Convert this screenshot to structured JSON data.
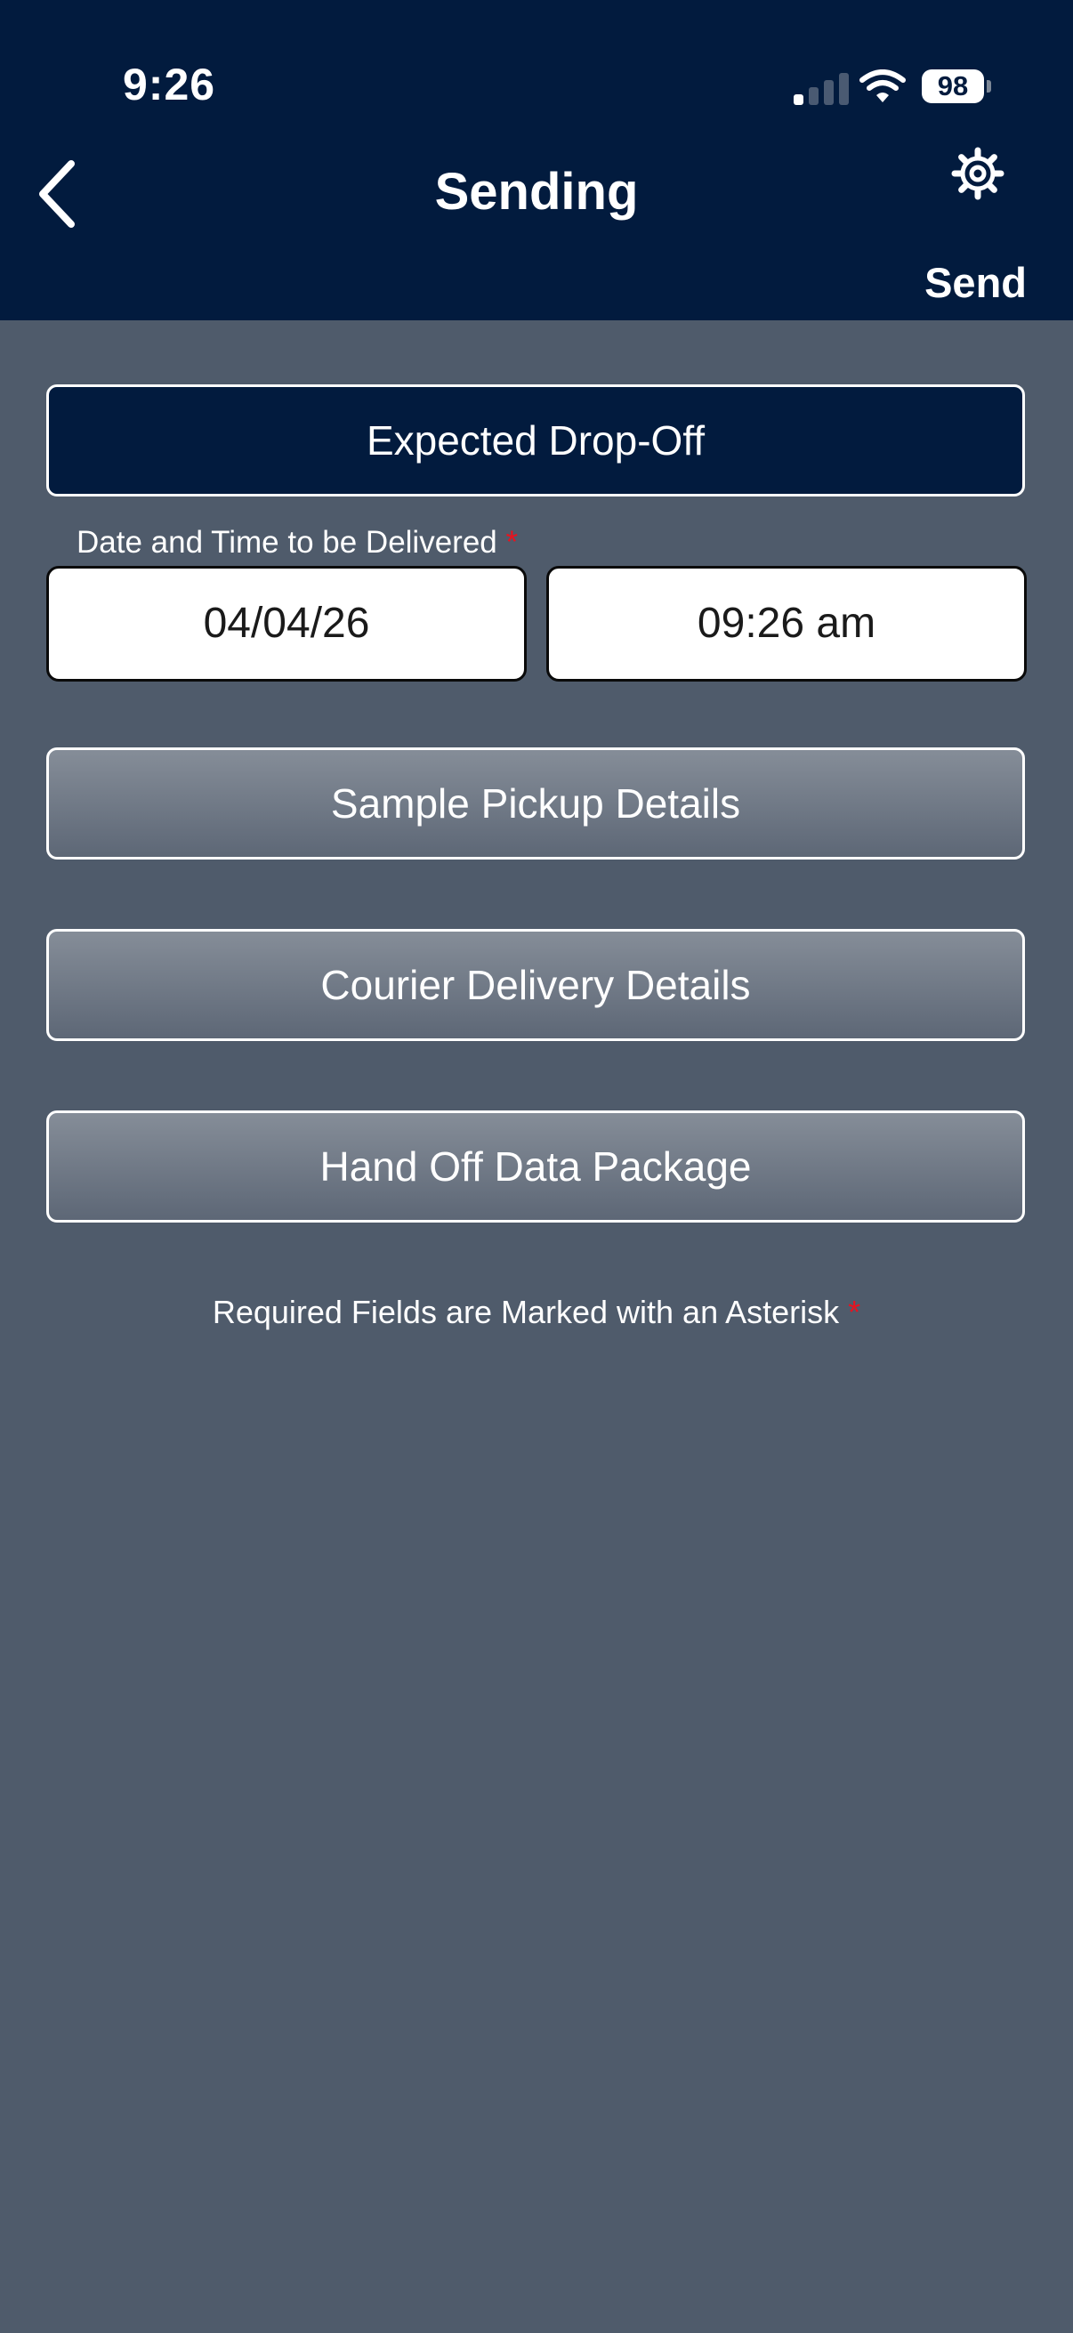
{
  "status_bar": {
    "time": "9:26",
    "battery_level": "98",
    "signal_icon": "cellular-signal-icon",
    "wifi_icon": "wifi-icon"
  },
  "header": {
    "title": "Sending",
    "back_icon": "chevron-left-icon",
    "settings_icon": "gear-icon",
    "send_label": "Send"
  },
  "sections": {
    "expected_dropoff": "Expected Drop-Off",
    "sample_pickup": "Sample Pickup Details",
    "courier_delivery": "Courier Delivery Details",
    "hand_off": "Hand Off Data Package"
  },
  "delivery": {
    "label": "Date and Time to be Delivered",
    "required_marker": "*",
    "date": "04/04/26",
    "time": "09:26 am"
  },
  "footer": {
    "note": "Required Fields are Marked with an Asterisk",
    "required_marker": "*"
  },
  "colors": {
    "header_bg": "#021b3e",
    "page_bg": "#4f5b6b",
    "required": "#e8131f"
  }
}
